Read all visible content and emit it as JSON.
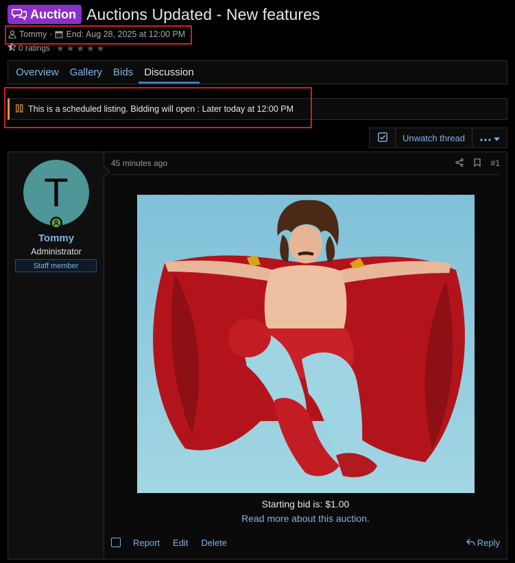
{
  "thread": {
    "prefix": "Auction",
    "title": "Auctions Updated - New features",
    "author": "Tommy",
    "end_label": "End: Aug 28, 2025 at 12:00 PM",
    "ratings": "0 ratings",
    "star_count": 5
  },
  "tabs": [
    {
      "label": "Overview"
    },
    {
      "label": "Gallery"
    },
    {
      "label": "Bids"
    },
    {
      "label": "Discussion",
      "active": true
    }
  ],
  "notice": {
    "text": "This is a scheduled listing. Bidding will open : Later today at 12:00 PM"
  },
  "thread_actions": {
    "unwatch": "Unwatch thread"
  },
  "post": {
    "time": "45 minutes ago",
    "number": "#1",
    "user": {
      "avatar_letter": "T",
      "name": "Tommy",
      "title": "Administrator",
      "badge": "Staff member"
    },
    "bid_text": "Starting bid is: $1.00",
    "read_more": "Read more about this auction.",
    "footer": {
      "report": "Report",
      "edit": "Edit",
      "delete": "Delete",
      "reply": "Reply"
    }
  },
  "colors": {
    "prefix_bg": "#8b2fc9",
    "link": "#7fb4e6",
    "notice_accent": "#e49b2c",
    "avatar_bg": "#4e9698",
    "highlight_outline": "#d21f1f"
  }
}
